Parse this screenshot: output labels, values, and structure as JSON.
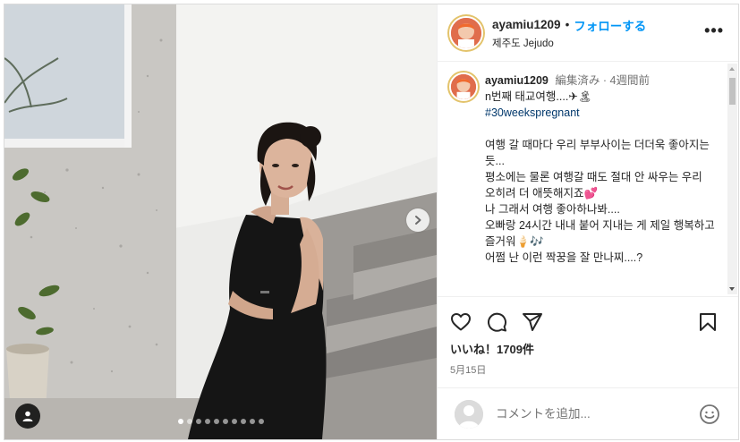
{
  "post": {
    "username": "ayamiu1209",
    "separator": "•",
    "follow_label": "フォローする",
    "location": "제주도 Jejudo",
    "more_icon": "more-horizontal-icon",
    "more_label": "•••"
  },
  "caption": {
    "username": "ayamiu1209",
    "edited": "編集済み",
    "dot": "·",
    "time_ago": "4週間前",
    "lines_top": [
      "n번째 태교여행....✈🏝"
    ],
    "hashtag": "#30weekspregnant",
    "lines_body": [
      "여행 갈 때마다 우리 부부사이는 더더욱 좋아지는 듯...",
      "평소에는 물론 여행갈 때도 절대 안 싸우는 우리",
      "오히려 더 애뜻해지죠💕",
      "나 그래서 여행 좋아하나봐....",
      "오빠랑 24시간 내내 붙어 지내는 게 제일 행복하고",
      "즐거워🍦🎶",
      "어쩜 난 이런 짝꿍을 잘 만나찌....?"
    ]
  },
  "actions": {
    "like_icon": "heart-icon",
    "comment_icon": "comment-icon",
    "share_icon": "send-icon",
    "save_icon": "bookmark-icon",
    "likes_text": "いいね！1709件",
    "date": "5月15日"
  },
  "comment_box": {
    "placeholder": "コメントを追加...",
    "emoji_icon": "smile-icon"
  },
  "carousel": {
    "slide_count": 10,
    "active_index": 0,
    "next_icon": "chevron-right-icon",
    "tag_icon": "user-tag-icon"
  },
  "colors": {
    "accent": "#0095f6",
    "hashtag": "#00376b",
    "muted": "#737373"
  }
}
